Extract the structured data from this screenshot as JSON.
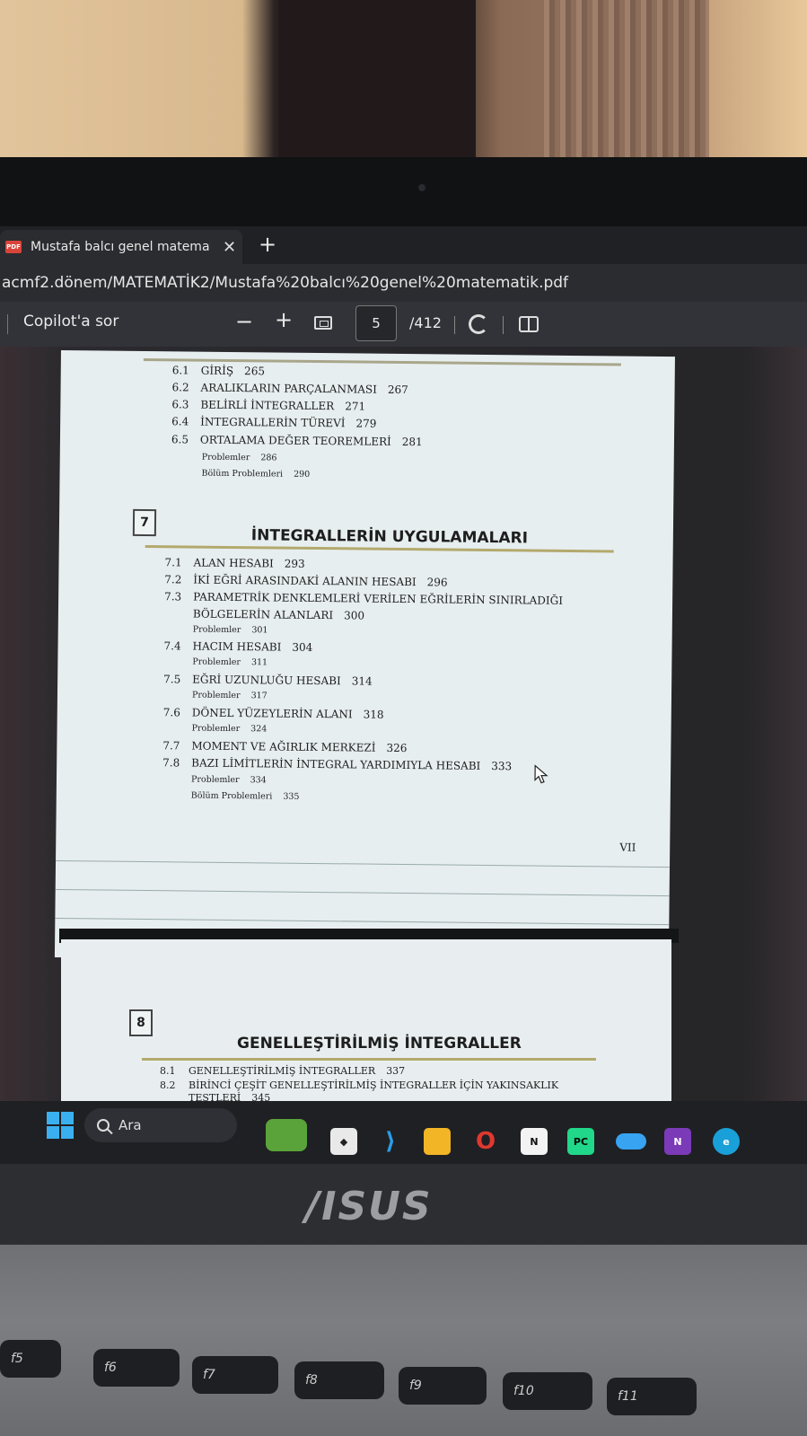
{
  "browser": {
    "tab_title": "Mustafa balcı genel matematik.p",
    "tab_close": "✕",
    "new_tab": "+",
    "address": "acmf2.dönem/MATEMATİK2/Mustafa%20balcı%20genel%20matematik.pdf"
  },
  "pdf_toolbar": {
    "copilot_label": "Copilot'a sor",
    "zoom_out": "−",
    "zoom_in": "+",
    "current_page": "5",
    "page_total": "/412"
  },
  "page1": {
    "ch6_entries": [
      {
        "num": "6.1",
        "title": "GİRİŞ",
        "page": "265"
      },
      {
        "num": "6.2",
        "title": "ARALIKLARIN PARÇALANMASI",
        "page": "267"
      },
      {
        "num": "6.3",
        "title": "BELİRLİ İNTEGRALLER",
        "page": "271"
      },
      {
        "num": "6.4",
        "title": "İNTEGRALLERİN TÜREVİ",
        "page": "279"
      },
      {
        "num": "6.5",
        "title": "ORTALAMA DEĞER TEOREMLERİ",
        "page": "281"
      }
    ],
    "ch6_sub": [
      {
        "title": "Problemler",
        "page": "286"
      },
      {
        "title": "Bölüm Problemleri",
        "page": "290"
      }
    ],
    "ch7_number": "7",
    "ch7_title": "İNTEGRALLERİN UYGULAMALARI",
    "ch7_lines": {
      "e1": {
        "num": "7.1",
        "title": "ALAN HESABI",
        "page": "293"
      },
      "e2": {
        "num": "7.2",
        "title": "İKİ EĞRİ ARASINDAKİ ALANIN HESABI",
        "page": "296"
      },
      "e3": {
        "num": "7.3",
        "title": "PARAMETRİK DENKLEMLERİ VERİLEN EĞRİLERİN SINIRLADIĞI"
      },
      "e3b": {
        "title": "BÖLGELERİN ALANLARI",
        "page": "300"
      },
      "p1": {
        "title": "Problemler",
        "page": "301"
      },
      "e4": {
        "num": "7.4",
        "title": "HACIM HESABI",
        "page": "304"
      },
      "p2": {
        "title": "Problemler",
        "page": "311"
      },
      "e5": {
        "num": "7.5",
        "title": "EĞRİ UZUNLUĞU HESABI",
        "page": "314"
      },
      "p3": {
        "title": "Problemler",
        "page": "317"
      },
      "e6": {
        "num": "7.6",
        "title": "DÖNEL YÜZEYLERİN ALANI",
        "page": "318"
      },
      "p4": {
        "title": "Problemler",
        "page": "324"
      },
      "e7": {
        "num": "7.7",
        "title": "MOMENT VE AĞIRLIK MERKEZİ",
        "page": "326"
      },
      "e8": {
        "num": "7.8",
        "title": "BAZI LİMİTLERİN İNTEGRAL YARDIMIYLA HESABI",
        "page": "333"
      },
      "p5": {
        "title": "Problemler",
        "page": "334"
      },
      "p6": {
        "title": "Bölüm Problemleri",
        "page": "335"
      }
    },
    "roman_page": "VII"
  },
  "page2": {
    "ch8_number": "8",
    "ch8_title": "GENELLEŞTİRİLMİŞ İNTEGRALLER",
    "e1": {
      "num": "8.1",
      "title": "GENELLEŞTİRİLMİŞ İNTEGRALLER",
      "page": "337"
    },
    "e2": {
      "num": "8.2",
      "title": "BİRİNCİ ÇEŞİT GENELLEŞTİRİLMİŞ İNTEGRALLER İÇİN YAKINSAKLIK"
    },
    "e2b": {
      "title": "TESTLERİ",
      "page": "345"
    }
  },
  "taskbar": {
    "search_label": "Ara",
    "apps": [
      "minecraft-icon",
      "app-store-icon",
      "vscode-icon",
      "file-explorer-icon",
      "opera-icon",
      "notion-icon",
      "pycharm-icon",
      "onedrive-icon",
      "onenote-icon",
      "edge-icon"
    ]
  },
  "laptop": {
    "brand": "/ISUS",
    "keys": [
      "f5",
      "f6",
      "f7",
      "f8",
      "f9",
      "f10",
      "f11"
    ]
  }
}
